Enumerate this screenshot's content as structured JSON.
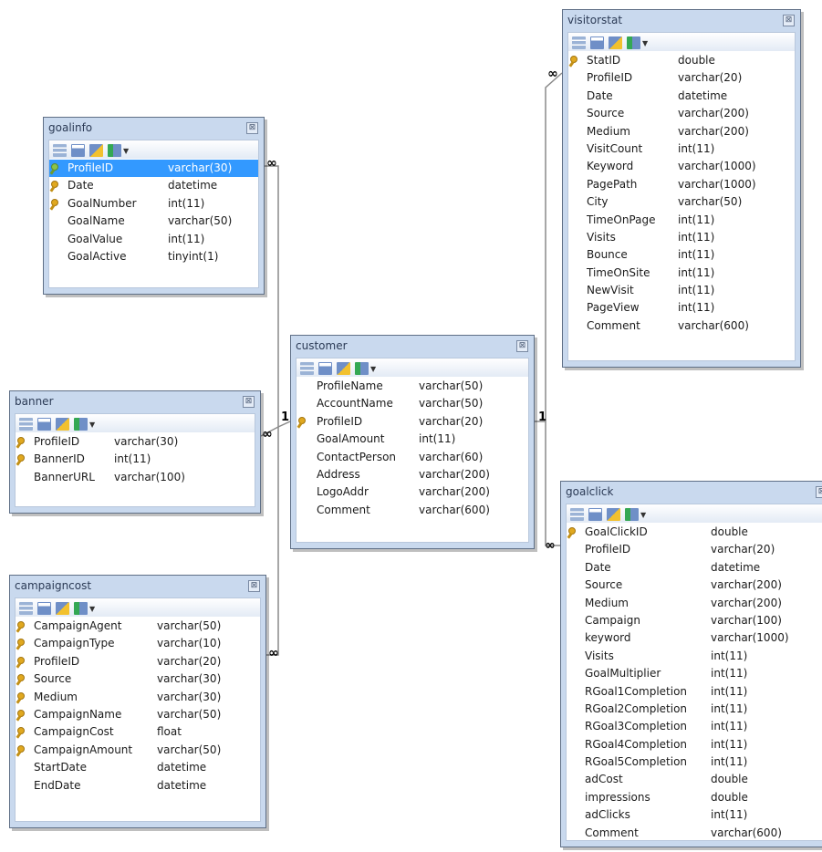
{
  "tables": {
    "goalinfo": {
      "title": "goalinfo",
      "columns": [
        {
          "name": "ProfileID",
          "type": "varchar(30)",
          "key": "green",
          "selected": true
        },
        {
          "name": "Date",
          "type": "datetime",
          "key": "gold"
        },
        {
          "name": "GoalNumber",
          "type": "int(11)",
          "key": "gold"
        },
        {
          "name": "GoalName",
          "type": "varchar(50)"
        },
        {
          "name": "GoalValue",
          "type": "int(11)"
        },
        {
          "name": "GoalActive",
          "type": "tinyint(1)"
        }
      ]
    },
    "banner": {
      "title": "banner",
      "columns": [
        {
          "name": "ProfileID",
          "type": "varchar(30)",
          "key": "gold"
        },
        {
          "name": "BannerID",
          "type": "int(11)",
          "key": "gold"
        },
        {
          "name": "BannerURL",
          "type": "varchar(100)"
        }
      ]
    },
    "campaigncost": {
      "title": "campaigncost",
      "columns": [
        {
          "name": "CampaignAgent",
          "type": "varchar(50)",
          "key": "gold"
        },
        {
          "name": "CampaignType",
          "type": "varchar(10)",
          "key": "gold"
        },
        {
          "name": "ProfileID",
          "type": "varchar(20)",
          "key": "gold"
        },
        {
          "name": "Source",
          "type": "varchar(30)",
          "key": "gold"
        },
        {
          "name": "Medium",
          "type": "varchar(30)",
          "key": "gold"
        },
        {
          "name": "CampaignName",
          "type": "varchar(50)",
          "key": "gold"
        },
        {
          "name": "CampaignCost",
          "type": "float",
          "key": "gold"
        },
        {
          "name": "CampaignAmount",
          "type": "varchar(50)",
          "key": "gold"
        },
        {
          "name": "StartDate",
          "type": "datetime"
        },
        {
          "name": "EndDate",
          "type": "datetime"
        }
      ]
    },
    "customer": {
      "title": "customer",
      "columns": [
        {
          "name": "ProfileName",
          "type": "varchar(50)"
        },
        {
          "name": "AccountName",
          "type": "varchar(50)"
        },
        {
          "name": "ProfileID",
          "type": "varchar(20)",
          "key": "gold"
        },
        {
          "name": "GoalAmount",
          "type": "int(11)"
        },
        {
          "name": "ContactPerson",
          "type": "varchar(60)"
        },
        {
          "name": "Address",
          "type": "varchar(200)"
        },
        {
          "name": "LogoAddr",
          "type": "varchar(200)"
        },
        {
          "name": "Comment",
          "type": "varchar(600)"
        }
      ]
    },
    "visitorstat": {
      "title": "visitorstat",
      "columns": [
        {
          "name": "StatID",
          "type": "double",
          "key": "gold"
        },
        {
          "name": "ProfileID",
          "type": "varchar(20)"
        },
        {
          "name": "Date",
          "type": "datetime"
        },
        {
          "name": "Source",
          "type": "varchar(200)"
        },
        {
          "name": "Medium",
          "type": "varchar(200)"
        },
        {
          "name": "VisitCount",
          "type": "int(11)"
        },
        {
          "name": "Keyword",
          "type": "varchar(1000)"
        },
        {
          "name": "PagePath",
          "type": "varchar(1000)"
        },
        {
          "name": "City",
          "type": "varchar(50)"
        },
        {
          "name": "TimeOnPage",
          "type": "int(11)"
        },
        {
          "name": "Visits",
          "type": "int(11)"
        },
        {
          "name": "Bounce",
          "type": "int(11)"
        },
        {
          "name": "TimeOnSite",
          "type": "int(11)"
        },
        {
          "name": "NewVisit",
          "type": "int(11)"
        },
        {
          "name": "PageView",
          "type": "int(11)"
        },
        {
          "name": "Comment",
          "type": "varchar(600)"
        }
      ]
    },
    "goalclick": {
      "title": "goalclick",
      "columns": [
        {
          "name": "GoalClickID",
          "type": "double",
          "key": "gold"
        },
        {
          "name": "ProfileID",
          "type": "varchar(20)"
        },
        {
          "name": "Date",
          "type": "datetime"
        },
        {
          "name": "Source",
          "type": "varchar(200)"
        },
        {
          "name": "Medium",
          "type": "varchar(200)"
        },
        {
          "name": "Campaign",
          "type": "varchar(100)"
        },
        {
          "name": "keyword",
          "type": "varchar(1000)"
        },
        {
          "name": "Visits",
          "type": "int(11)"
        },
        {
          "name": "GoalMultiplier",
          "type": "int(11)"
        },
        {
          "name": "RGoal1Completion",
          "type": "int(11)"
        },
        {
          "name": "RGoal2Completion",
          "type": "int(11)"
        },
        {
          "name": "RGoal3Completion",
          "type": "int(11)"
        },
        {
          "name": "RGoal4Completion",
          "type": "int(11)"
        },
        {
          "name": "RGoal5Completion",
          "type": "int(11)"
        },
        {
          "name": "adCost",
          "type": "double"
        },
        {
          "name": "impressions",
          "type": "double"
        },
        {
          "name": "adClicks",
          "type": "int(11)"
        },
        {
          "name": "Comment",
          "type": "varchar(600)"
        }
      ]
    }
  },
  "relation_labels": {
    "one": "1",
    "many": "∞"
  },
  "close_glyph": "⊠",
  "colors": {
    "title_bar": "#c9d9ee",
    "selected_row": "#3399ff",
    "connector": "#8a8a8a"
  }
}
